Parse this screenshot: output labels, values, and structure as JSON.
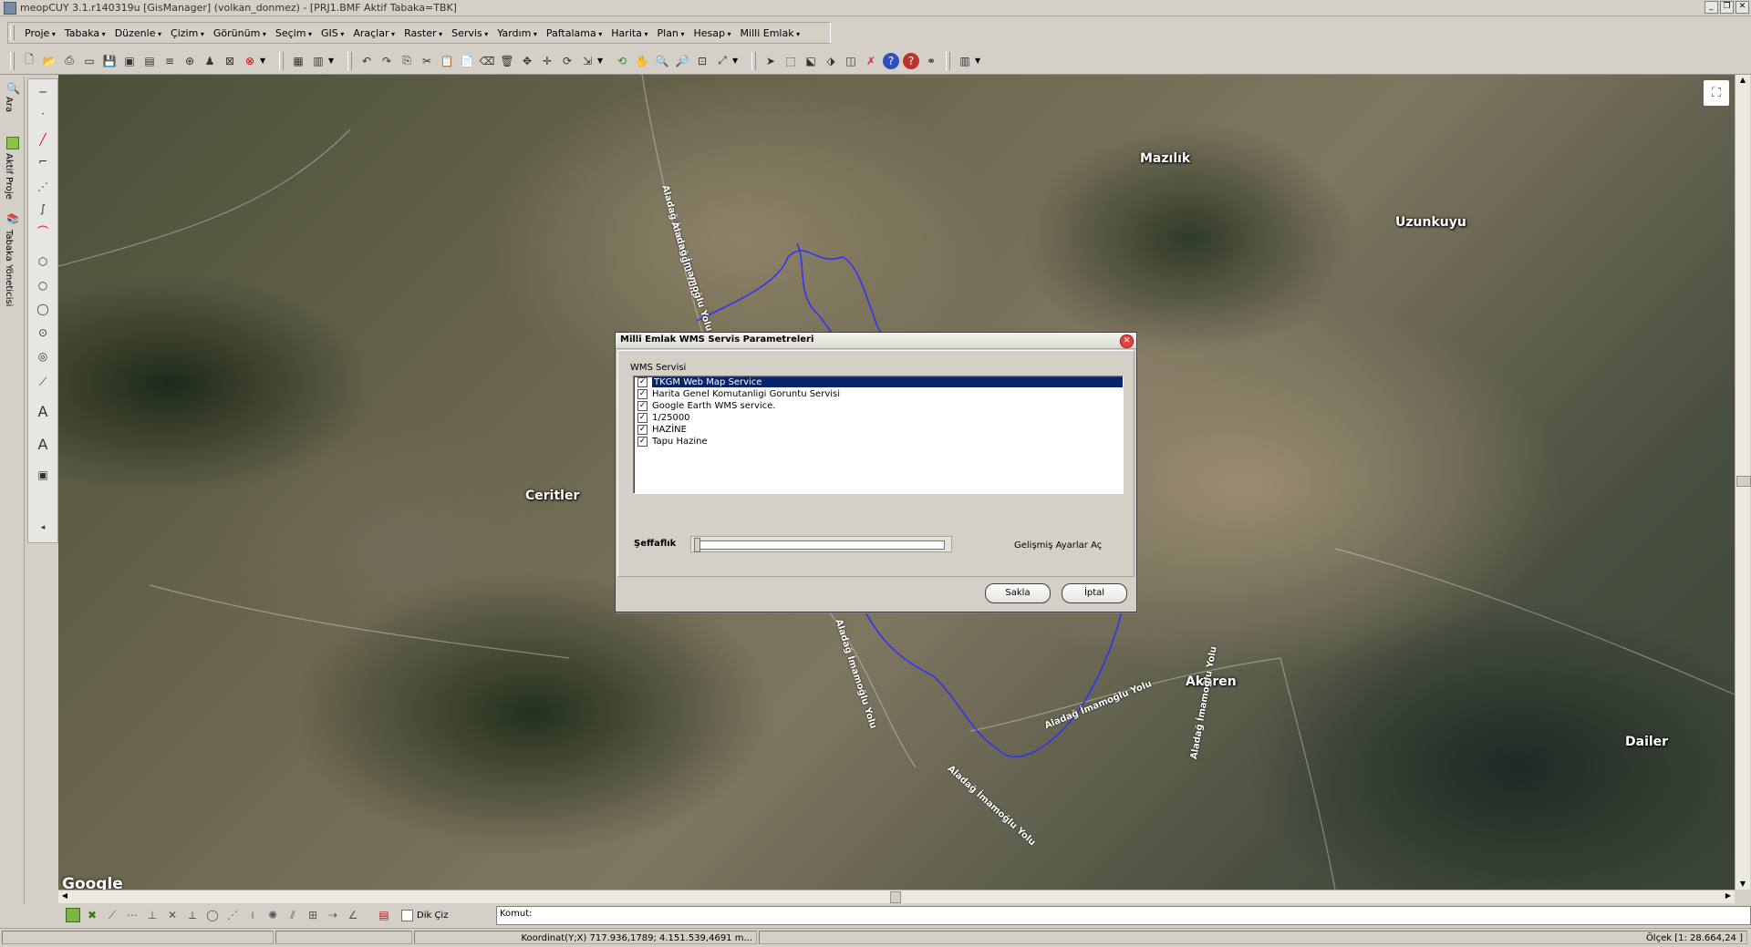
{
  "window": {
    "title": "meopCUY 3.1.r140319u [GisManager] (volkan_donmez)  - [PRJ1.BMF  Aktif Tabaka=TBK]"
  },
  "menu": [
    "Proje",
    "Tabaka",
    "Düzenle",
    "Çizim",
    "Görünüm",
    "Seçim",
    "GIS",
    "Araçlar",
    "Raster",
    "Servis",
    "Yardım",
    "Paftalama",
    "Harita",
    "Plan",
    "Hesap",
    "Milli Emlak"
  ],
  "left_tabs": {
    "ara": "Ara",
    "aktif_proje": "Aktif Proje",
    "tabaka_yoneticisi": "Tabaka Yöneticisi"
  },
  "map": {
    "places": [
      "Mazılık",
      "Uzunkuyu",
      "Ceritler",
      "Akören",
      "Dailer"
    ],
    "road": "Aladağ İmamoğlu Yolu",
    "attribution": "Google"
  },
  "dialog": {
    "title": "Milli Emlak WMS Servis Parametreleri",
    "group_label": "WMS Servisi",
    "services": [
      {
        "label": "TKGM  Web Map Service",
        "checked": true,
        "selected": true
      },
      {
        "label": "Harita Genel Komutanligi Goruntu Servisi",
        "checked": true,
        "selected": false
      },
      {
        "label": "Google Earth WMS service.",
        "checked": true,
        "selected": false
      },
      {
        "label": "1/25000",
        "checked": true,
        "selected": false
      },
      {
        "label": "HAZİNE",
        "checked": true,
        "selected": false
      },
      {
        "label": "Tapu Hazine",
        "checked": true,
        "selected": false
      }
    ],
    "transparency_label": "Şeffaflık",
    "transparency_value": 0,
    "advanced_label": "Gelişmiş Ayarlar Aç",
    "save_label": "Sakla",
    "cancel_label": "İptal"
  },
  "bottom": {
    "dik_ciz_label": "Dik Çiz",
    "command_prompt": "Komut:"
  },
  "status": {
    "coordinate": "Koordinat(Y;X)  717.936,1789; 4.151.539,4691 m...",
    "scale": "Ölçek [1: 28.664,24 ]"
  }
}
